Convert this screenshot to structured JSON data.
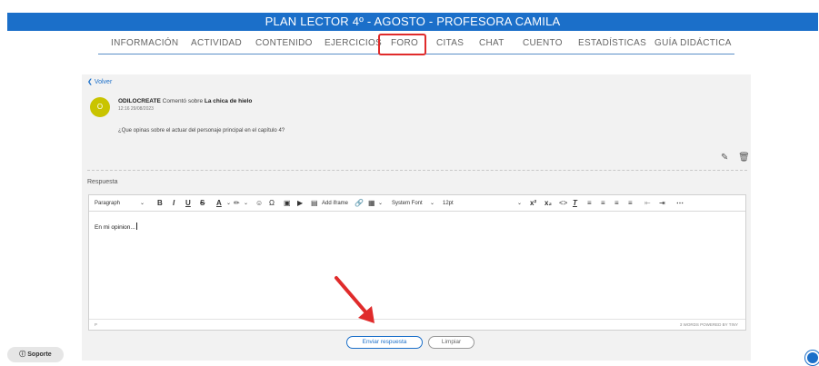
{
  "header": {
    "title": "PLAN LECTOR 4º - AGOSTO - PROFESORA CAMILA"
  },
  "tabs": [
    {
      "label": "INFORMACIÓN"
    },
    {
      "label": "ACTIVIDAD"
    },
    {
      "label": "CONTENIDO"
    },
    {
      "label": "EJERCICIOS"
    },
    {
      "label": "FORO"
    },
    {
      "label": "CITAS"
    },
    {
      "label": "CHAT"
    },
    {
      "label": "CUENTO"
    },
    {
      "label": "ESTADÍSTICAS"
    },
    {
      "label": "GUÍA DIDÁCTICA"
    }
  ],
  "active_tab": "FORO",
  "back_label": "Volver",
  "post": {
    "avatar_letter": "O",
    "author": "ODILOCREATE",
    "action": "Comentó sobre",
    "topic": "La chica de hielo",
    "time": "12:16 29/08/2023",
    "comment": "¿Que opinas sobre el actuar del personaje principal en el capítulo 4?"
  },
  "response": {
    "label": "Respuesta",
    "format_select": "Paragraph",
    "font_select": "System Font",
    "size_select": "12pt",
    "iframe_label": "Add iframe",
    "body_text": "En mi opinion...",
    "status_path": "P",
    "status_info": "3 WORDS  POWERED BY TINY"
  },
  "buttons": {
    "send": "Enviar respuesta",
    "clear": "Limpiar"
  },
  "support_label": "Soporte",
  "colors": {
    "header_blue": "#1b6fc9",
    "highlight_red": "#e02b2b",
    "avatar_yellow": "#c9c400"
  }
}
